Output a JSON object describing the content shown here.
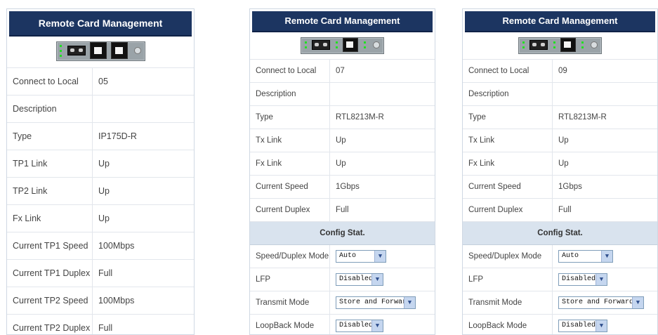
{
  "panels": [
    {
      "title": "Remote Card Management",
      "rows": [
        {
          "label": "Connect to Local",
          "value": "05"
        },
        {
          "label": "Description",
          "value": ""
        },
        {
          "label": "Type",
          "value": "IP175D-R"
        },
        {
          "label": "TP1 Link",
          "value": "Up"
        },
        {
          "label": "TP2 Link",
          "value": "Up"
        },
        {
          "label": "Fx Link",
          "value": "Up"
        },
        {
          "label": "Current TP1 Speed",
          "value": "100Mbps"
        },
        {
          "label": "Current TP1 Duplex",
          "value": "Full"
        },
        {
          "label": "Current TP2 Speed",
          "value": "100Mbps"
        },
        {
          "label": "Current TP2 Duplex",
          "value": "Full"
        }
      ]
    },
    {
      "title": "Remote Card Management",
      "rows": [
        {
          "label": "Connect to Local",
          "value": "07"
        },
        {
          "label": "Description",
          "value": ""
        },
        {
          "label": "Type",
          "value": "RTL8213M-R"
        },
        {
          "label": "Tx Link",
          "value": "Up"
        },
        {
          "label": "Fx Link",
          "value": "Up"
        },
        {
          "label": "Current Speed",
          "value": "1Gbps"
        },
        {
          "label": "Current Duplex",
          "value": "Full"
        }
      ],
      "section": "Config Stat.",
      "config": [
        {
          "label": "Speed/Duplex Mode",
          "value": "Auto"
        },
        {
          "label": "LFP",
          "value": "Disabled"
        },
        {
          "label": "Transmit Mode",
          "value": "Store and Forward"
        },
        {
          "label": "LoopBack Mode",
          "value": "Disabled"
        }
      ]
    },
    {
      "title": "Remote Card Management",
      "rows": [
        {
          "label": "Connect to Local",
          "value": "09"
        },
        {
          "label": "Description",
          "value": ""
        },
        {
          "label": "Type",
          "value": "RTL8213M-R"
        },
        {
          "label": "Tx Link",
          "value": "Up"
        },
        {
          "label": "Fx Link",
          "value": "Up"
        },
        {
          "label": "Current Speed",
          "value": "1Gbps"
        },
        {
          "label": "Current Duplex",
          "value": "Full"
        }
      ],
      "section": "Config Stat.",
      "config": [
        {
          "label": "Speed/Duplex Mode",
          "value": "Auto"
        },
        {
          "label": "LFP",
          "value": "Disabled"
        },
        {
          "label": "Transmit Mode",
          "value": "Store and Forward"
        },
        {
          "label": "LoopBack Mode",
          "value": "Disabled"
        }
      ]
    }
  ],
  "icons": {
    "card": "media-converter-card-icon",
    "led": "link-led-icon",
    "fiber": "fiber-port-icon",
    "rj45": "rj45-port-icon",
    "screw": "screw-icon",
    "dropdown": "chevron-down-icon"
  },
  "colors": {
    "title_bg": "#1c3561",
    "section_bg": "#d9e3ee",
    "led": "#22e022"
  }
}
